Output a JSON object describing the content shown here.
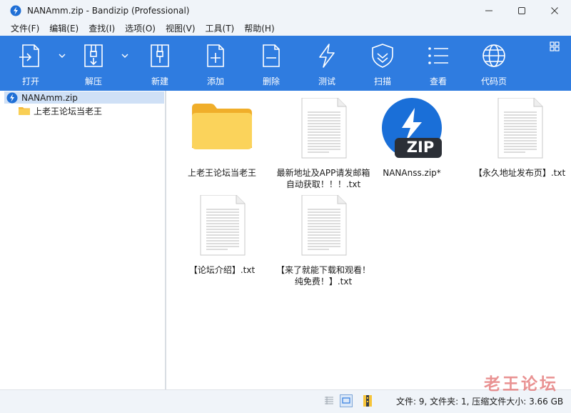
{
  "window": {
    "title": "NANAmm.zip - Bandizip (Professional)"
  },
  "menu": {
    "items": [
      "文件(F)",
      "编辑(E)",
      "查找(I)",
      "选项(O)",
      "视图(V)",
      "工具(T)",
      "帮助(H)"
    ]
  },
  "toolbar": {
    "open_label": "打开",
    "extract_label": "解压",
    "new_label": "新建",
    "add_label": "添加",
    "delete_label": "删除",
    "test_label": "测试",
    "scan_label": "扫描",
    "view_label": "查看",
    "codepage_label": "代码页"
  },
  "tree": {
    "root_label": "NANAmm.zip",
    "child_label": "上老王论坛当老王"
  },
  "files": [
    {
      "name": "上老王论坛当老王",
      "type": "folder"
    },
    {
      "name": "最新地址及APP请发邮箱自动获取！！！.txt",
      "type": "txt"
    },
    {
      "name": "NANAnss.zip*",
      "type": "zip"
    },
    {
      "name": "【永久地址发布页】.txt",
      "type": "txt"
    },
    {
      "name": "【论坛介绍】.txt",
      "type": "txt"
    },
    {
      "name": "【来了就能下载和观看！纯免费！】.txt",
      "type": "txt"
    }
  ],
  "file_lines": {
    "f1_line1": "上老王论坛当老王",
    "f2_line1": "最新地址及APP请发邮箱",
    "f2_line2": "自动获取！！！.txt",
    "f3_line1": "NANAnss.zip*",
    "f4_line1": "【永久地址发布页】.txt",
    "f5_line1": "【论坛介绍】.txt",
    "f6_line1": "【来了就能下载和观看！",
    "f6_line2": "纯免费！】.txt"
  },
  "status": {
    "text": "文件: 9, 文件夹: 1, 压缩文件大小: 3.66 GB"
  },
  "zip_badge": "ZIP",
  "watermark": "老王论坛",
  "colors": {
    "toolbar": "#2f7ce0",
    "selection": "#cfe0f6",
    "folder": "#f7c948"
  }
}
